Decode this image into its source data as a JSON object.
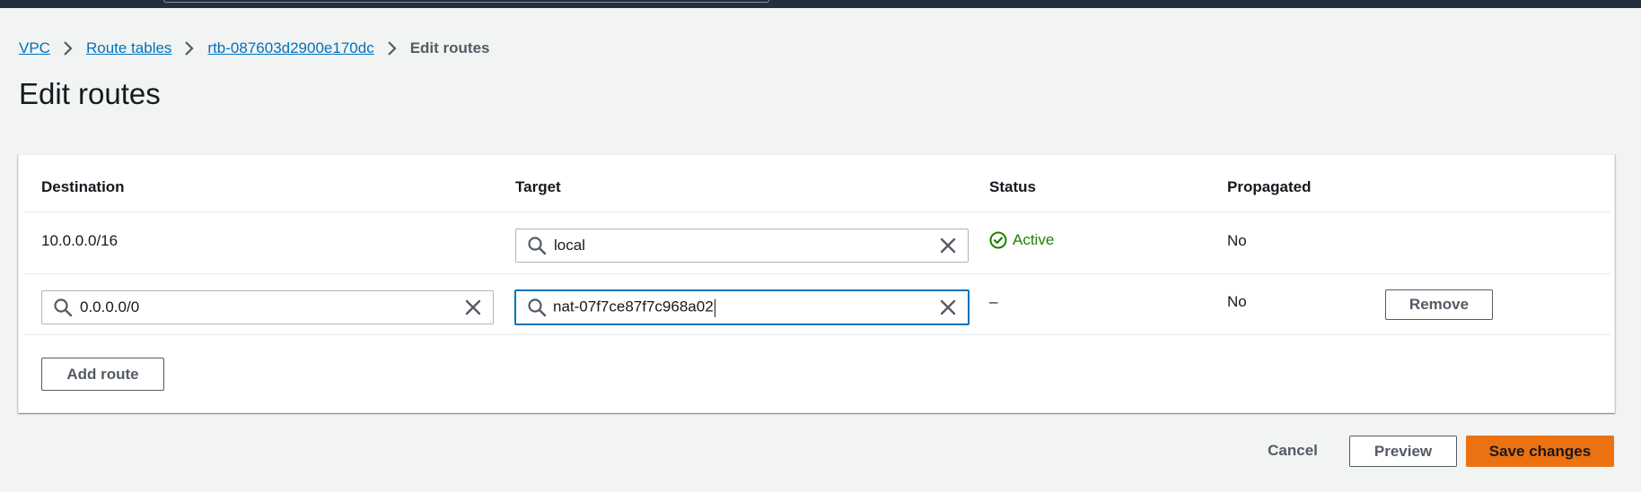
{
  "breadcrumb": {
    "items": [
      {
        "label": "VPC"
      },
      {
        "label": "Route tables"
      },
      {
        "label": "rtb-087603d2900e170dc"
      }
    ],
    "current": "Edit routes"
  },
  "page": {
    "title": "Edit routes"
  },
  "table": {
    "headers": {
      "destination": "Destination",
      "target": "Target",
      "status": "Status",
      "propagated": "Propagated"
    },
    "rows": [
      {
        "destination": "10.0.0.0/16",
        "target": "local",
        "status": "Active",
        "propagated": "No"
      },
      {
        "destination": "0.0.0.0/0",
        "target": "nat-07f7ce87f7c968a02",
        "status": "–",
        "propagated": "No",
        "remove_label": "Remove"
      }
    ],
    "add_route_label": "Add route"
  },
  "actions": {
    "cancel_label": "Cancel",
    "preview_label": "Preview",
    "save_label": "Save changes"
  },
  "colors": {
    "link": "#0073bb",
    "primary": "#ec7211",
    "success": "#1d8102",
    "focus": "#0073bb",
    "topbar": "#232f3e"
  },
  "icons": {
    "breadcrumb_separator": "chevron-right-icon",
    "search": "search-icon",
    "clear": "close-icon",
    "status": "check-circle-icon"
  }
}
